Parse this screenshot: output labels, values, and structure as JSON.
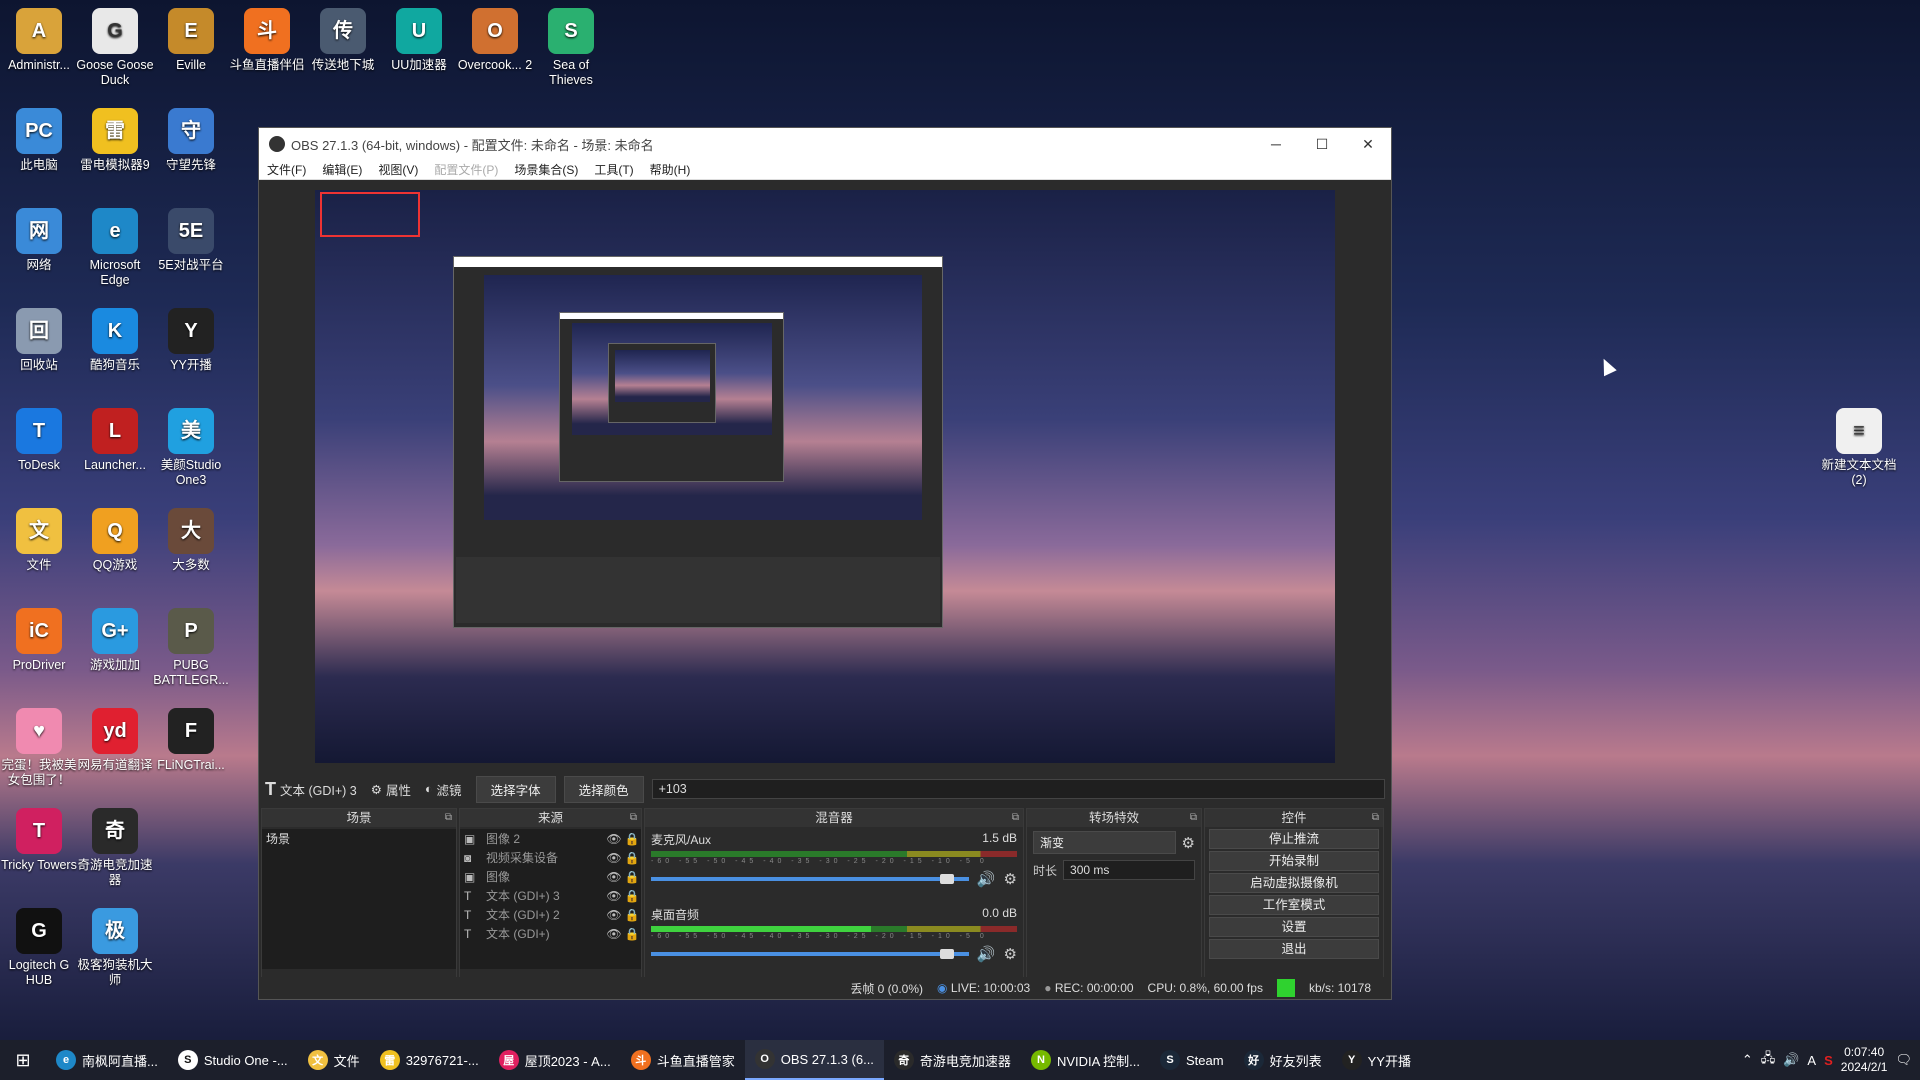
{
  "desktop": {
    "icons": [
      {
        "label": "Administr...",
        "color": "#d9a33a",
        "glyph": "A"
      },
      {
        "label": "Goose Goose Duck",
        "color": "#e8e8e8",
        "glyph": "G"
      },
      {
        "label": "Eville",
        "color": "#c58a2a",
        "glyph": "E"
      },
      {
        "label": "斗鱼直播伴侣",
        "color": "#f07020",
        "glyph": "斗"
      },
      {
        "label": "传送地下城",
        "color": "#4a5a70",
        "glyph": "传"
      },
      {
        "label": "UU加速器",
        "color": "#10a8a0",
        "glyph": "U"
      },
      {
        "label": "Overcook... 2",
        "color": "#d07030",
        "glyph": "O"
      },
      {
        "label": "Sea of Thieves",
        "color": "#2ab070",
        "glyph": "S"
      },
      {
        "label": "此电脑",
        "color": "#3a8ad8",
        "glyph": "PC"
      },
      {
        "label": "雷电模拟器9",
        "color": "#f0c020",
        "glyph": "雷"
      },
      {
        "label": "守望先锋",
        "color": "#3a7ad0",
        "glyph": "守"
      },
      {
        "label": "网络",
        "color": "#3a8ad8",
        "glyph": "网"
      },
      {
        "label": "Microsoft Edge",
        "color": "#1e88c8",
        "glyph": "e"
      },
      {
        "label": "5E对战平台",
        "color": "#3a4a6a",
        "glyph": "5E"
      },
      {
        "label": "回收站",
        "color": "#8a9ab0",
        "glyph": "回"
      },
      {
        "label": "酷狗音乐",
        "color": "#1a8ae0",
        "glyph": "K"
      },
      {
        "label": "YY开播",
        "color": "#222222",
        "glyph": "Y"
      },
      {
        "label": "ToDesk",
        "color": "#1a78e0",
        "glyph": "T"
      },
      {
        "label": "Launcher...",
        "color": "#c02020",
        "glyph": "L"
      },
      {
        "label": "美颜Studio One3",
        "color": "#20a0e0",
        "glyph": "美"
      },
      {
        "label": "文件",
        "color": "#f0c040",
        "glyph": "文"
      },
      {
        "label": "QQ游戏",
        "color": "#f0a020",
        "glyph": "Q"
      },
      {
        "label": "大多数",
        "color": "#6a4a3a",
        "glyph": "大"
      },
      {
        "label": "ProDriver",
        "color": "#f07020",
        "glyph": "iC"
      },
      {
        "label": "游戏加加",
        "color": "#2a9ae0",
        "glyph": "G+"
      },
      {
        "label": "PUBG BATTLEGR...",
        "color": "#5a5a4a",
        "glyph": "P"
      },
      {
        "label": "完蛋！我被美女包围了！",
        "color": "#f08ab0",
        "glyph": "♥"
      },
      {
        "label": "网易有道翻译",
        "color": "#e02030",
        "glyph": "yd"
      },
      {
        "label": "FLiNGTrai...",
        "color": "#222222",
        "glyph": "F"
      },
      {
        "label": "Tricky Towers",
        "color": "#d02060",
        "glyph": "T"
      },
      {
        "label": "奇游电竞加速器",
        "color": "#2a2a2a",
        "glyph": "奇"
      },
      {
        "label": "Logitech G HUB",
        "color": "#111111",
        "glyph": "G"
      },
      {
        "label": "极客狗装机大师",
        "color": "#3a9ae0",
        "glyph": "极"
      },
      {
        "label": "新建文本文档 (2)",
        "color": "#f0f0f0",
        "glyph": "≡"
      }
    ]
  },
  "obs": {
    "title": "OBS 27.1.3 (64-bit, windows) - 配置文件: 未命名 - 场景: 未命名",
    "menu": [
      "文件(F)",
      "编辑(E)",
      "视图(V)",
      "配置文件(P)",
      "场景集合(S)",
      "工具(T)",
      "帮助(H)"
    ],
    "textbar": {
      "source_name": "文本 (GDI+) 3",
      "properties": "属性",
      "filters": "滤镜",
      "select_font": "选择字体",
      "select_color": "选择颜色",
      "text_value": "+103"
    },
    "scenes": {
      "header": "场景",
      "items": [
        "场景"
      ]
    },
    "sources": {
      "header": "来源",
      "items": [
        {
          "name": "图像 2",
          "icon": "image-icon"
        },
        {
          "name": "视频采集设备",
          "icon": "camera-icon"
        },
        {
          "name": "图像",
          "icon": "image-icon"
        },
        {
          "name": "文本 (GDI+) 3",
          "icon": "text-icon"
        },
        {
          "name": "文本 (GDI+) 2",
          "icon": "text-icon"
        },
        {
          "name": "文本 (GDI+)",
          "icon": "text-icon"
        }
      ]
    },
    "mixer": {
      "header": "混音器",
      "channels": [
        {
          "name": "麦克风/Aux",
          "db": "1.5 dB",
          "level": 0.0,
          "volume": 0.93
        },
        {
          "name": "桌面音频",
          "db": "0.0 dB",
          "level": 0.6,
          "volume": 0.93
        }
      ],
      "ticks": "-60 -55 -50 -45 -40 -35 -30 -25 -20 -15 -10 -5 0"
    },
    "transitions": {
      "header": "转场特效",
      "selected": "渐变",
      "duration_label": "时长",
      "duration": "300 ms"
    },
    "controls": {
      "header": "控件",
      "buttons": [
        "停止推流",
        "开始录制",
        "启动虚拟摄像机",
        "工作室模式",
        "设置",
        "退出"
      ]
    },
    "status": {
      "dropped": "丢帧 0 (0.0%)",
      "live": "LIVE: 10:00:03",
      "rec": "REC: 00:00:00",
      "cpu": "CPU: 0.8%, 60.00 fps",
      "kbps": "kb/s: 10178"
    }
  },
  "taskbar": {
    "items": [
      {
        "label": "南枫阿直播...",
        "color": "#1e88c8",
        "glyph": "e"
      },
      {
        "label": "Studio One -...",
        "color": "#ffffff",
        "glyph": "S"
      },
      {
        "label": "文件",
        "color": "#f0c040",
        "glyph": "文"
      },
      {
        "label": "32976721-...",
        "color": "#f0c020",
        "glyph": "雷"
      },
      {
        "label": "屋顶2023 - A...",
        "color": "#e02060",
        "glyph": "屋"
      },
      {
        "label": "斗鱼直播管家",
        "color": "#f07020",
        "glyph": "斗"
      },
      {
        "label": "OBS 27.1.3 (6...",
        "color": "#333333",
        "glyph": "O"
      },
      {
        "label": "奇游电竞加速器",
        "color": "#2a2a2a",
        "glyph": "奇"
      },
      {
        "label": "NVIDIA 控制...",
        "color": "#76b900",
        "glyph": "N"
      },
      {
        "label": "Steam",
        "color": "#1b2838",
        "glyph": "S"
      },
      {
        "label": "好友列表",
        "color": "#1b2838",
        "glyph": "好"
      },
      {
        "label": "YY开播",
        "color": "#222222",
        "glyph": "Y"
      }
    ],
    "tray_ime": "A",
    "time": "0:07:40",
    "date": "2024/2/1"
  }
}
